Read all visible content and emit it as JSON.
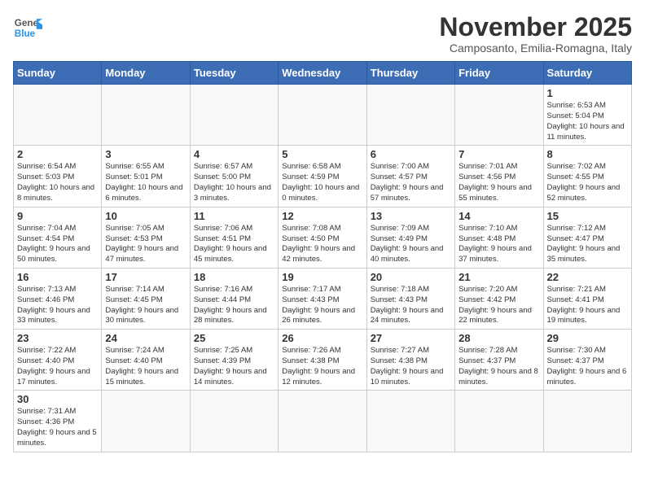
{
  "header": {
    "logo_general": "General",
    "logo_blue": "Blue",
    "month_title": "November 2025",
    "subtitle": "Camposanto, Emilia-Romagna, Italy"
  },
  "weekdays": [
    "Sunday",
    "Monday",
    "Tuesday",
    "Wednesday",
    "Thursday",
    "Friday",
    "Saturday"
  ],
  "weeks": [
    [
      {
        "day": "",
        "info": ""
      },
      {
        "day": "",
        "info": ""
      },
      {
        "day": "",
        "info": ""
      },
      {
        "day": "",
        "info": ""
      },
      {
        "day": "",
        "info": ""
      },
      {
        "day": "",
        "info": ""
      },
      {
        "day": "1",
        "info": "Sunrise: 6:53 AM\nSunset: 5:04 PM\nDaylight: 10 hours and 11 minutes."
      }
    ],
    [
      {
        "day": "2",
        "info": "Sunrise: 6:54 AM\nSunset: 5:03 PM\nDaylight: 10 hours and 8 minutes."
      },
      {
        "day": "3",
        "info": "Sunrise: 6:55 AM\nSunset: 5:01 PM\nDaylight: 10 hours and 6 minutes."
      },
      {
        "day": "4",
        "info": "Sunrise: 6:57 AM\nSunset: 5:00 PM\nDaylight: 10 hours and 3 minutes."
      },
      {
        "day": "5",
        "info": "Sunrise: 6:58 AM\nSunset: 4:59 PM\nDaylight: 10 hours and 0 minutes."
      },
      {
        "day": "6",
        "info": "Sunrise: 7:00 AM\nSunset: 4:57 PM\nDaylight: 9 hours and 57 minutes."
      },
      {
        "day": "7",
        "info": "Sunrise: 7:01 AM\nSunset: 4:56 PM\nDaylight: 9 hours and 55 minutes."
      },
      {
        "day": "8",
        "info": "Sunrise: 7:02 AM\nSunset: 4:55 PM\nDaylight: 9 hours and 52 minutes."
      }
    ],
    [
      {
        "day": "9",
        "info": "Sunrise: 7:04 AM\nSunset: 4:54 PM\nDaylight: 9 hours and 50 minutes."
      },
      {
        "day": "10",
        "info": "Sunrise: 7:05 AM\nSunset: 4:53 PM\nDaylight: 9 hours and 47 minutes."
      },
      {
        "day": "11",
        "info": "Sunrise: 7:06 AM\nSunset: 4:51 PM\nDaylight: 9 hours and 45 minutes."
      },
      {
        "day": "12",
        "info": "Sunrise: 7:08 AM\nSunset: 4:50 PM\nDaylight: 9 hours and 42 minutes."
      },
      {
        "day": "13",
        "info": "Sunrise: 7:09 AM\nSunset: 4:49 PM\nDaylight: 9 hours and 40 minutes."
      },
      {
        "day": "14",
        "info": "Sunrise: 7:10 AM\nSunset: 4:48 PM\nDaylight: 9 hours and 37 minutes."
      },
      {
        "day": "15",
        "info": "Sunrise: 7:12 AM\nSunset: 4:47 PM\nDaylight: 9 hours and 35 minutes."
      }
    ],
    [
      {
        "day": "16",
        "info": "Sunrise: 7:13 AM\nSunset: 4:46 PM\nDaylight: 9 hours and 33 minutes."
      },
      {
        "day": "17",
        "info": "Sunrise: 7:14 AM\nSunset: 4:45 PM\nDaylight: 9 hours and 30 minutes."
      },
      {
        "day": "18",
        "info": "Sunrise: 7:16 AM\nSunset: 4:44 PM\nDaylight: 9 hours and 28 minutes."
      },
      {
        "day": "19",
        "info": "Sunrise: 7:17 AM\nSunset: 4:43 PM\nDaylight: 9 hours and 26 minutes."
      },
      {
        "day": "20",
        "info": "Sunrise: 7:18 AM\nSunset: 4:43 PM\nDaylight: 9 hours and 24 minutes."
      },
      {
        "day": "21",
        "info": "Sunrise: 7:20 AM\nSunset: 4:42 PM\nDaylight: 9 hours and 22 minutes."
      },
      {
        "day": "22",
        "info": "Sunrise: 7:21 AM\nSunset: 4:41 PM\nDaylight: 9 hours and 19 minutes."
      }
    ],
    [
      {
        "day": "23",
        "info": "Sunrise: 7:22 AM\nSunset: 4:40 PM\nDaylight: 9 hours and 17 minutes."
      },
      {
        "day": "24",
        "info": "Sunrise: 7:24 AM\nSunset: 4:40 PM\nDaylight: 9 hours and 15 minutes."
      },
      {
        "day": "25",
        "info": "Sunrise: 7:25 AM\nSunset: 4:39 PM\nDaylight: 9 hours and 14 minutes."
      },
      {
        "day": "26",
        "info": "Sunrise: 7:26 AM\nSunset: 4:38 PM\nDaylight: 9 hours and 12 minutes."
      },
      {
        "day": "27",
        "info": "Sunrise: 7:27 AM\nSunset: 4:38 PM\nDaylight: 9 hours and 10 minutes."
      },
      {
        "day": "28",
        "info": "Sunrise: 7:28 AM\nSunset: 4:37 PM\nDaylight: 9 hours and 8 minutes."
      },
      {
        "day": "29",
        "info": "Sunrise: 7:30 AM\nSunset: 4:37 PM\nDaylight: 9 hours and 6 minutes."
      }
    ],
    [
      {
        "day": "30",
        "info": "Sunrise: 7:31 AM\nSunset: 4:36 PM\nDaylight: 9 hours and 5 minutes."
      },
      {
        "day": "",
        "info": ""
      },
      {
        "day": "",
        "info": ""
      },
      {
        "day": "",
        "info": ""
      },
      {
        "day": "",
        "info": ""
      },
      {
        "day": "",
        "info": ""
      },
      {
        "day": "",
        "info": ""
      }
    ]
  ]
}
